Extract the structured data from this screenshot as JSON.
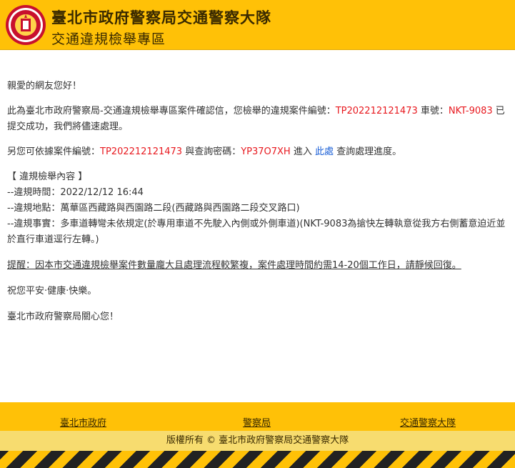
{
  "header": {
    "title": "臺北市政府警察局交通警察大隊",
    "subtitle": "交通違規檢舉專區",
    "logo_icon": "police-badge-icon"
  },
  "message": {
    "greeting": "親愛的網友您好！",
    "confirm_prefix": "此為臺北市政府警察局-交通違規檢舉專區案件確認信，您檢舉的違規案件編號：",
    "case_number": "TP202212121473",
    "plate_label": " 車號：",
    "plate": "NKT-9083",
    "confirm_suffix": " 已提交成功，我們將儘速處理。",
    "query_prefix": "另您可依據案件編號：",
    "query_case_number": "TP202212121473",
    "query_middle": " 與查詢密碼：",
    "query_password": "YP37O7XH",
    "query_enter": " 進入 ",
    "query_link": "此處",
    "query_suffix": " 查詢處理進度。",
    "section_title": "【 違規檢舉內容 】",
    "time_line": "--違規時間：2022/12/12 16:44",
    "location_line": "--違規地點：萬華區西藏路與西園路二段(西藏路與西園路二段交叉路口)",
    "fact_line": "--違規事實：多車道轉彎未依規定(於專用車道不先駛入內側或外側車道)(NKT-9083為搶快左轉執意從我方右側蓄意迫近並於直行車道逕行左轉。)",
    "notice": "提醒：因本市交通違規檢舉案件數量龐大且處理流程較繁複，案件處理時間約需14-20個工作日，請靜候回復。",
    "wish": "祝您平安‧健康‧快樂。",
    "sign": "臺北市政府警察局關心您！"
  },
  "footer": {
    "links": [
      "臺北市政府",
      "警察局",
      "交通警察大隊"
    ],
    "copyright": "版權所有 © 臺北市政府警察局交通警察大隊"
  },
  "colors": {
    "header_bg": "#ffc107",
    "highlight_red": "#e8191f",
    "link_blue": "#1a5fd6"
  }
}
